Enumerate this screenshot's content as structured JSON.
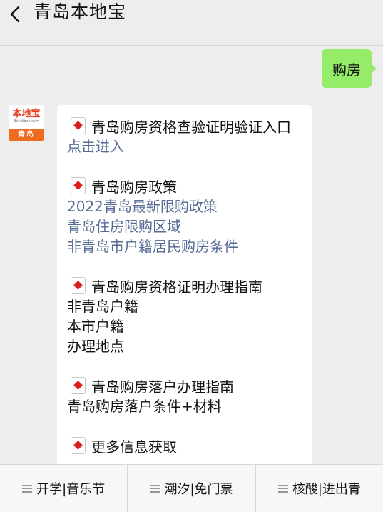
{
  "header": {
    "title": "青岛本地宝"
  },
  "chat": {
    "user_message": "购房",
    "avatar": {
      "brand": "本地宝",
      "sub": "Bendibao.com",
      "city": "青岛"
    },
    "sections": [
      {
        "title": "青岛购房资格查验证明验证入口",
        "lines": [
          {
            "text": "点击进入",
            "type": "link"
          }
        ]
      },
      {
        "title": "青岛购房政策",
        "lines": [
          {
            "text": "2022青岛最新限购政策",
            "type": "link"
          },
          {
            "text": "青岛住房限购区域",
            "type": "link"
          },
          {
            "text": "非青岛市户籍居民购房条件",
            "type": "link"
          }
        ]
      },
      {
        "title": "青岛购房资格证明办理指南",
        "lines": [
          {
            "text": "非青岛户籍",
            "type": "plain"
          },
          {
            "text": "本市户籍",
            "type": "plain"
          },
          {
            "text": "办理地点",
            "type": "plain"
          }
        ]
      },
      {
        "title": "青岛购房落户办理指南",
        "lines": [
          {
            "text": "青岛购房落户条件+材料",
            "type": "plain"
          }
        ]
      },
      {
        "title": "更多信息获取",
        "lines": []
      }
    ]
  },
  "menu": {
    "items": [
      {
        "label": "开学|音乐节"
      },
      {
        "label": "潮汐|免门票"
      },
      {
        "label": "核酸|进出青"
      }
    ]
  },
  "colors": {
    "link": "#576b95",
    "user_bubble": "#95ec69",
    "background": "#ededed"
  }
}
